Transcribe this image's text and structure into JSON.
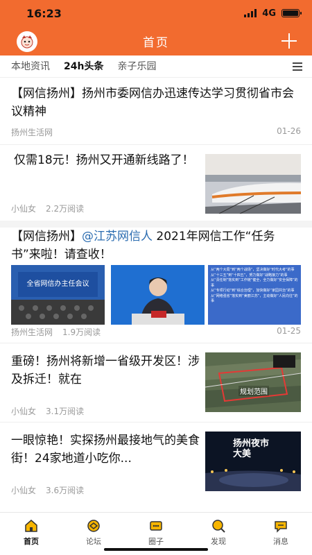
{
  "status": {
    "time": "16:23",
    "network": "4G"
  },
  "header": {
    "title": "首页"
  },
  "tabs": [
    "本地资讯",
    "24h头条",
    "亲子乐园"
  ],
  "feed": [
    {
      "title": "【网信扬州】扬州市委网信办迅速传达学习贯彻省市会议精神",
      "source": "扬州生活网",
      "reads": "",
      "date": "01-26"
    },
    {
      "title": "仅需18元！扬州又开通新线路了！",
      "source": "小仙女",
      "reads": "2.2万阅读",
      "date": "",
      "thumb": "train-photo"
    },
    {
      "title_prefix": "【网信扬州】",
      "mention": "@江苏网信人",
      "title_suffix": " 2021年网信工作“任务书”来啦！请查收！",
      "source": "扬州生活网",
      "reads": "1.9万阅读",
      "date": "01-25",
      "images": [
        "conference-photo",
        "speaker-photo",
        "task-list-photo"
      ],
      "conference_banner": "全省网信办主任会议",
      "task_items": [
        "从“两个大局”到“两个战场”，坚决做好“时代大考”的事",
        "从“十三五”到“十四五”，努力做好“战略接力”的事",
        "从“责任制”落实到“工作链”健全，全力做好“安全保障”的事",
        "从“专项行动”到“综合治理”，加快做好“家园共治”的事",
        "从“网络强省”落实到“美丽江苏”，主动做好“人民向往”的事"
      ]
    },
    {
      "title": "重磅！扬州将新增一省级开发区！涉及拆迁！就在",
      "source": "小仙女",
      "reads": "3.1万阅读",
      "date": "",
      "thumb": "map-photo",
      "map_label": "规划范围"
    },
    {
      "title": "一眼惊艳！实探扬州最接地气的美食街！24家地道小吃你...",
      "source": "小仙女",
      "reads": "3.6万阅读",
      "date": "",
      "thumb": "night-street-photo",
      "poster_text": "扬州夜市大美"
    }
  ],
  "nav": [
    {
      "label": "首页",
      "icon": "home-icon"
    },
    {
      "label": "论坛",
      "icon": "forum-icon"
    },
    {
      "label": "圈子",
      "icon": "circle-icon"
    },
    {
      "label": "发现",
      "icon": "discover-icon"
    },
    {
      "label": "消息",
      "icon": "message-icon"
    }
  ],
  "colors": {
    "accent": "#f26b2f",
    "mention": "#2b6cb0"
  }
}
